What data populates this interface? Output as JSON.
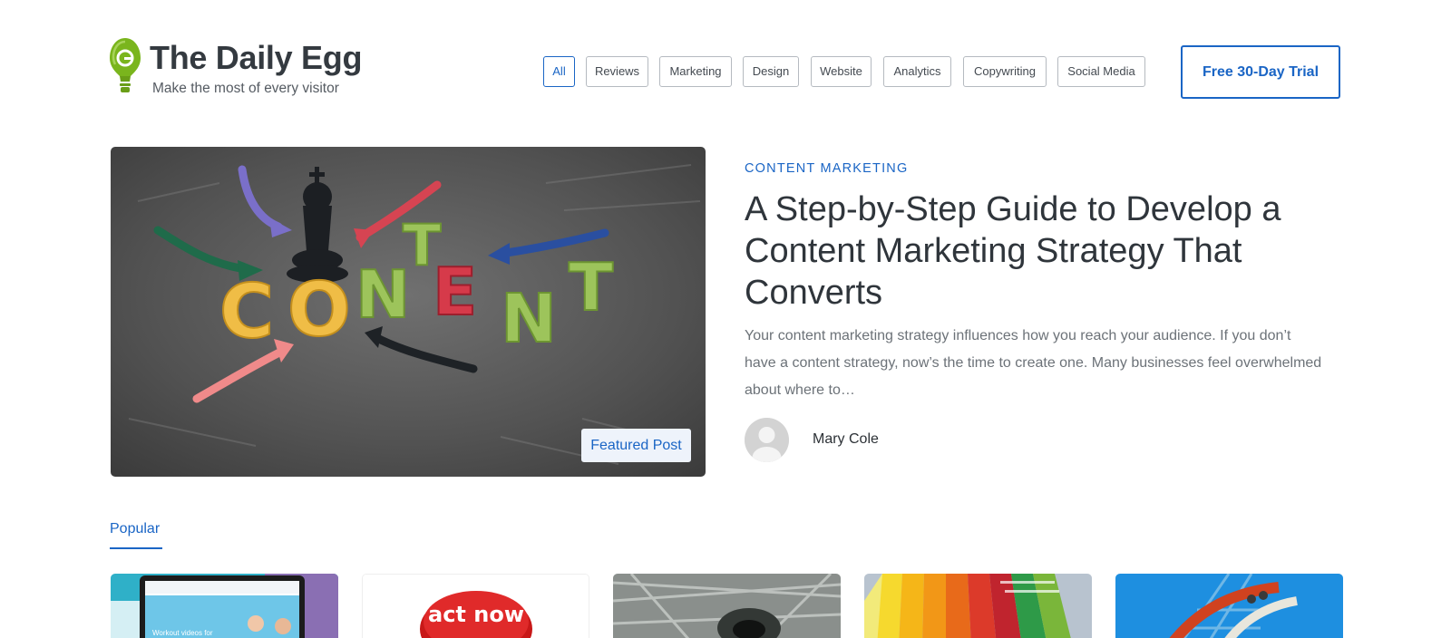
{
  "brand": {
    "name": "The Daily Egg",
    "tagline": "Make the most of every visitor",
    "logo_color": "#7ab51d"
  },
  "nav": {
    "categories": [
      "All",
      "Reviews",
      "Marketing",
      "Design",
      "Website",
      "Analytics",
      "Copywriting",
      "Social Media"
    ],
    "active": "All"
  },
  "cta": {
    "label": "Free 30-Day Trial"
  },
  "featured": {
    "badge": "Featured Post",
    "category": "CONTENT MARKETING",
    "title": "A Step-by-Step Guide to Develop a Content Marketing Strategy That Converts",
    "excerpt": "Your content marketing strategy influences how you reach your audience. If you don’t have a content strategy, now’s the time to create one. Many businesses feel overwhelmed about where to…",
    "author": "Mary Cole",
    "image_text": "CONTENT"
  },
  "popular": {
    "tab_label": "Popular",
    "cards": [
      {
        "thumb": "fitness-website-laptop",
        "caption_text": "Workout videos for"
      },
      {
        "thumb": "act-now-button",
        "caption_text": "act now"
      },
      {
        "thumb": "money-vortex"
      },
      {
        "thumb": "color-swatches"
      },
      {
        "thumb": "roller-coaster"
      }
    ]
  },
  "colors": {
    "accent": "#1a65c5",
    "text_dark": "#2f353b",
    "text_muted": "#6c7278"
  }
}
